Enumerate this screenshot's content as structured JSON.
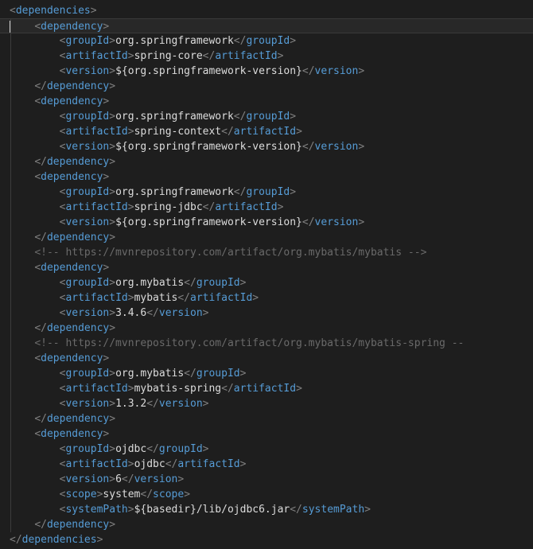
{
  "editor": {
    "lines": [
      [
        [
          "p",
          "<"
        ],
        [
          "t",
          "dependencies"
        ],
        [
          "p",
          ">"
        ]
      ],
      [
        [
          "x",
          "    "
        ],
        [
          "p",
          "<"
        ],
        [
          "t",
          "dependency"
        ],
        [
          "p",
          ">"
        ]
      ],
      [
        [
          "x",
          "        "
        ],
        [
          "p",
          "<"
        ],
        [
          "t",
          "groupId"
        ],
        [
          "p",
          ">"
        ],
        [
          "x",
          "org.springframework"
        ],
        [
          "p",
          "</"
        ],
        [
          "t",
          "groupId"
        ],
        [
          "p",
          ">"
        ]
      ],
      [
        [
          "x",
          "        "
        ],
        [
          "p",
          "<"
        ],
        [
          "t",
          "artifactId"
        ],
        [
          "p",
          ">"
        ],
        [
          "x",
          "spring-core"
        ],
        [
          "p",
          "</"
        ],
        [
          "t",
          "artifactId"
        ],
        [
          "p",
          ">"
        ]
      ],
      [
        [
          "x",
          "        "
        ],
        [
          "p",
          "<"
        ],
        [
          "t",
          "version"
        ],
        [
          "p",
          ">"
        ],
        [
          "x",
          "${org.springframework-version}"
        ],
        [
          "p",
          "</"
        ],
        [
          "t",
          "version"
        ],
        [
          "p",
          ">"
        ]
      ],
      [
        [
          "x",
          "    "
        ],
        [
          "p",
          "</"
        ],
        [
          "t",
          "dependency"
        ],
        [
          "p",
          ">"
        ]
      ],
      [
        [
          "x",
          "    "
        ],
        [
          "p",
          "<"
        ],
        [
          "t",
          "dependency"
        ],
        [
          "p",
          ">"
        ]
      ],
      [
        [
          "x",
          "        "
        ],
        [
          "p",
          "<"
        ],
        [
          "t",
          "groupId"
        ],
        [
          "p",
          ">"
        ],
        [
          "x",
          "org.springframework"
        ],
        [
          "p",
          "</"
        ],
        [
          "t",
          "groupId"
        ],
        [
          "p",
          ">"
        ]
      ],
      [
        [
          "x",
          "        "
        ],
        [
          "p",
          "<"
        ],
        [
          "t",
          "artifactId"
        ],
        [
          "p",
          ">"
        ],
        [
          "x",
          "spring-context"
        ],
        [
          "p",
          "</"
        ],
        [
          "t",
          "artifactId"
        ],
        [
          "p",
          ">"
        ]
      ],
      [
        [
          "x",
          "        "
        ],
        [
          "p",
          "<"
        ],
        [
          "t",
          "version"
        ],
        [
          "p",
          ">"
        ],
        [
          "x",
          "${org.springframework-version}"
        ],
        [
          "p",
          "</"
        ],
        [
          "t",
          "version"
        ],
        [
          "p",
          ">"
        ]
      ],
      [
        [
          "x",
          "    "
        ],
        [
          "p",
          "</"
        ],
        [
          "t",
          "dependency"
        ],
        [
          "p",
          ">"
        ]
      ],
      [
        [
          "x",
          "    "
        ],
        [
          "p",
          "<"
        ],
        [
          "t",
          "dependency"
        ],
        [
          "p",
          ">"
        ]
      ],
      [
        [
          "x",
          "        "
        ],
        [
          "p",
          "<"
        ],
        [
          "t",
          "groupId"
        ],
        [
          "p",
          ">"
        ],
        [
          "x",
          "org.springframework"
        ],
        [
          "p",
          "</"
        ],
        [
          "t",
          "groupId"
        ],
        [
          "p",
          ">"
        ]
      ],
      [
        [
          "x",
          "        "
        ],
        [
          "p",
          "<"
        ],
        [
          "t",
          "artifactId"
        ],
        [
          "p",
          ">"
        ],
        [
          "x",
          "spring-jdbc"
        ],
        [
          "p",
          "</"
        ],
        [
          "t",
          "artifactId"
        ],
        [
          "p",
          ">"
        ]
      ],
      [
        [
          "x",
          "        "
        ],
        [
          "p",
          "<"
        ],
        [
          "t",
          "version"
        ],
        [
          "p",
          ">"
        ],
        [
          "x",
          "${org.springframework-version}"
        ],
        [
          "p",
          "</"
        ],
        [
          "t",
          "version"
        ],
        [
          "p",
          ">"
        ]
      ],
      [
        [
          "x",
          "    "
        ],
        [
          "p",
          "</"
        ],
        [
          "t",
          "dependency"
        ],
        [
          "p",
          ">"
        ]
      ],
      [
        [
          "x",
          "    "
        ],
        [
          "c",
          "<!-- https://mvnrepository.com/artifact/org.mybatis/mybatis -->"
        ]
      ],
      [
        [
          "x",
          "    "
        ],
        [
          "p",
          "<"
        ],
        [
          "t",
          "dependency"
        ],
        [
          "p",
          ">"
        ]
      ],
      [
        [
          "x",
          "        "
        ],
        [
          "p",
          "<"
        ],
        [
          "t",
          "groupId"
        ],
        [
          "p",
          ">"
        ],
        [
          "x",
          "org.mybatis"
        ],
        [
          "p",
          "</"
        ],
        [
          "t",
          "groupId"
        ],
        [
          "p",
          ">"
        ]
      ],
      [
        [
          "x",
          "        "
        ],
        [
          "p",
          "<"
        ],
        [
          "t",
          "artifactId"
        ],
        [
          "p",
          ">"
        ],
        [
          "x",
          "mybatis"
        ],
        [
          "p",
          "</"
        ],
        [
          "t",
          "artifactId"
        ],
        [
          "p",
          ">"
        ]
      ],
      [
        [
          "x",
          "        "
        ],
        [
          "p",
          "<"
        ],
        [
          "t",
          "version"
        ],
        [
          "p",
          ">"
        ],
        [
          "x",
          "3.4.6"
        ],
        [
          "p",
          "</"
        ],
        [
          "t",
          "version"
        ],
        [
          "p",
          ">"
        ]
      ],
      [
        [
          "x",
          "    "
        ],
        [
          "p",
          "</"
        ],
        [
          "t",
          "dependency"
        ],
        [
          "p",
          ">"
        ]
      ],
      [
        [
          "x",
          "    "
        ],
        [
          "c",
          "<!-- https://mvnrepository.com/artifact/org.mybatis/mybatis-spring --"
        ]
      ],
      [
        [
          "x",
          "    "
        ],
        [
          "p",
          "<"
        ],
        [
          "t",
          "dependency"
        ],
        [
          "p",
          ">"
        ]
      ],
      [
        [
          "x",
          "        "
        ],
        [
          "p",
          "<"
        ],
        [
          "t",
          "groupId"
        ],
        [
          "p",
          ">"
        ],
        [
          "x",
          "org.mybatis"
        ],
        [
          "p",
          "</"
        ],
        [
          "t",
          "groupId"
        ],
        [
          "p",
          ">"
        ]
      ],
      [
        [
          "x",
          "        "
        ],
        [
          "p",
          "<"
        ],
        [
          "t",
          "artifactId"
        ],
        [
          "p",
          ">"
        ],
        [
          "x",
          "mybatis-spring"
        ],
        [
          "p",
          "</"
        ],
        [
          "t",
          "artifactId"
        ],
        [
          "p",
          ">"
        ]
      ],
      [
        [
          "x",
          "        "
        ],
        [
          "p",
          "<"
        ],
        [
          "t",
          "version"
        ],
        [
          "p",
          ">"
        ],
        [
          "x",
          "1.3.2"
        ],
        [
          "p",
          "</"
        ],
        [
          "t",
          "version"
        ],
        [
          "p",
          ">"
        ]
      ],
      [
        [
          "x",
          "    "
        ],
        [
          "p",
          "</"
        ],
        [
          "t",
          "dependency"
        ],
        [
          "p",
          ">"
        ]
      ],
      [
        [
          "x",
          "    "
        ],
        [
          "p",
          "<"
        ],
        [
          "t",
          "dependency"
        ],
        [
          "p",
          ">"
        ]
      ],
      [
        [
          "x",
          "        "
        ],
        [
          "p",
          "<"
        ],
        [
          "t",
          "groupId"
        ],
        [
          "p",
          ">"
        ],
        [
          "x",
          "ojdbc"
        ],
        [
          "p",
          "</"
        ],
        [
          "t",
          "groupId"
        ],
        [
          "p",
          ">"
        ]
      ],
      [
        [
          "x",
          "        "
        ],
        [
          "p",
          "<"
        ],
        [
          "t",
          "artifactId"
        ],
        [
          "p",
          ">"
        ],
        [
          "x",
          "ojdbc"
        ],
        [
          "p",
          "</"
        ],
        [
          "t",
          "artifactId"
        ],
        [
          "p",
          ">"
        ]
      ],
      [
        [
          "x",
          "        "
        ],
        [
          "p",
          "<"
        ],
        [
          "t",
          "version"
        ],
        [
          "p",
          ">"
        ],
        [
          "x",
          "6"
        ],
        [
          "p",
          "</"
        ],
        [
          "t",
          "version"
        ],
        [
          "p",
          ">"
        ]
      ],
      [
        [
          "x",
          "        "
        ],
        [
          "p",
          "<"
        ],
        [
          "t",
          "scope"
        ],
        [
          "p",
          ">"
        ],
        [
          "x",
          "system"
        ],
        [
          "p",
          "</"
        ],
        [
          "t",
          "scope"
        ],
        [
          "p",
          ">"
        ]
      ],
      [
        [
          "x",
          "        "
        ],
        [
          "p",
          "<"
        ],
        [
          "t",
          "systemPath"
        ],
        [
          "p",
          ">"
        ],
        [
          "x",
          "${basedir}/lib/ojdbc6.jar"
        ],
        [
          "p",
          "</"
        ],
        [
          "t",
          "systemPath"
        ],
        [
          "p",
          ">"
        ]
      ],
      [
        [
          "x",
          "    "
        ],
        [
          "p",
          "</"
        ],
        [
          "t",
          "dependency"
        ],
        [
          "p",
          ">"
        ]
      ],
      [
        [
          "p",
          "</"
        ],
        [
          "t",
          "dependencies"
        ],
        [
          "p",
          ">"
        ]
      ]
    ]
  },
  "theme": {
    "background": "#1e1e1e",
    "tag_color": "#569cd6",
    "bracket_color": "#808080",
    "text_color": "#dcdcdc",
    "comment_color": "#6a6a6a"
  }
}
